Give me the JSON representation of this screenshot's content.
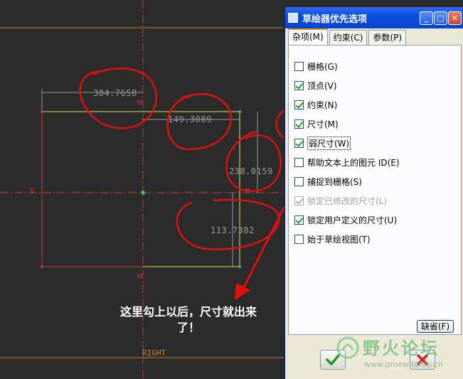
{
  "sketch": {
    "dimensions": [
      "304.7658",
      "149.3089",
      "238.0159",
      "113.7382"
    ],
    "axis_labels": {
      "h_top": "H",
      "h_bottom": "H",
      "v_left": "V",
      "v_right": "V",
      "right_plane": "RIGHT"
    }
  },
  "annotation": {
    "text": "这里勾上以后，尺寸就出来了！"
  },
  "dialog": {
    "title": "草绘器优先选项",
    "tabs": [
      {
        "label": "杂项(M)",
        "active": true
      },
      {
        "label": "约束(C)",
        "active": false
      },
      {
        "label": "参数(P)",
        "active": false
      }
    ],
    "options": [
      {
        "label": "栅格(G)",
        "checked": false,
        "enabled": true
      },
      {
        "label": "顶点(V)",
        "checked": true,
        "enabled": true
      },
      {
        "label": "约束(N)",
        "checked": true,
        "enabled": true
      },
      {
        "label": "尺寸(M)",
        "checked": true,
        "enabled": true
      },
      {
        "label": "弱尺寸(W)",
        "checked": true,
        "enabled": true
      },
      {
        "label": "帮助文本上的图元 ID(E)",
        "checked": false,
        "enabled": true
      },
      {
        "label": "捕捉到栅格(S)",
        "checked": false,
        "enabled": true
      },
      {
        "label": "锁定已修改的尺寸(L)",
        "checked": true,
        "enabled": false
      },
      {
        "label": "锁定用户定义的尺寸(U)",
        "checked": true,
        "enabled": true
      },
      {
        "label": "始于草绘视图(T)",
        "checked": false,
        "enabled": true
      }
    ],
    "default_label": "缺省(F)"
  },
  "watermark": {
    "title": "野火论坛",
    "url": "www.proewildfire.cn"
  },
  "colors": {
    "sketch_line": "#e6e05a",
    "axis": "#c43b3b",
    "annotation_stroke": "#e01010"
  }
}
